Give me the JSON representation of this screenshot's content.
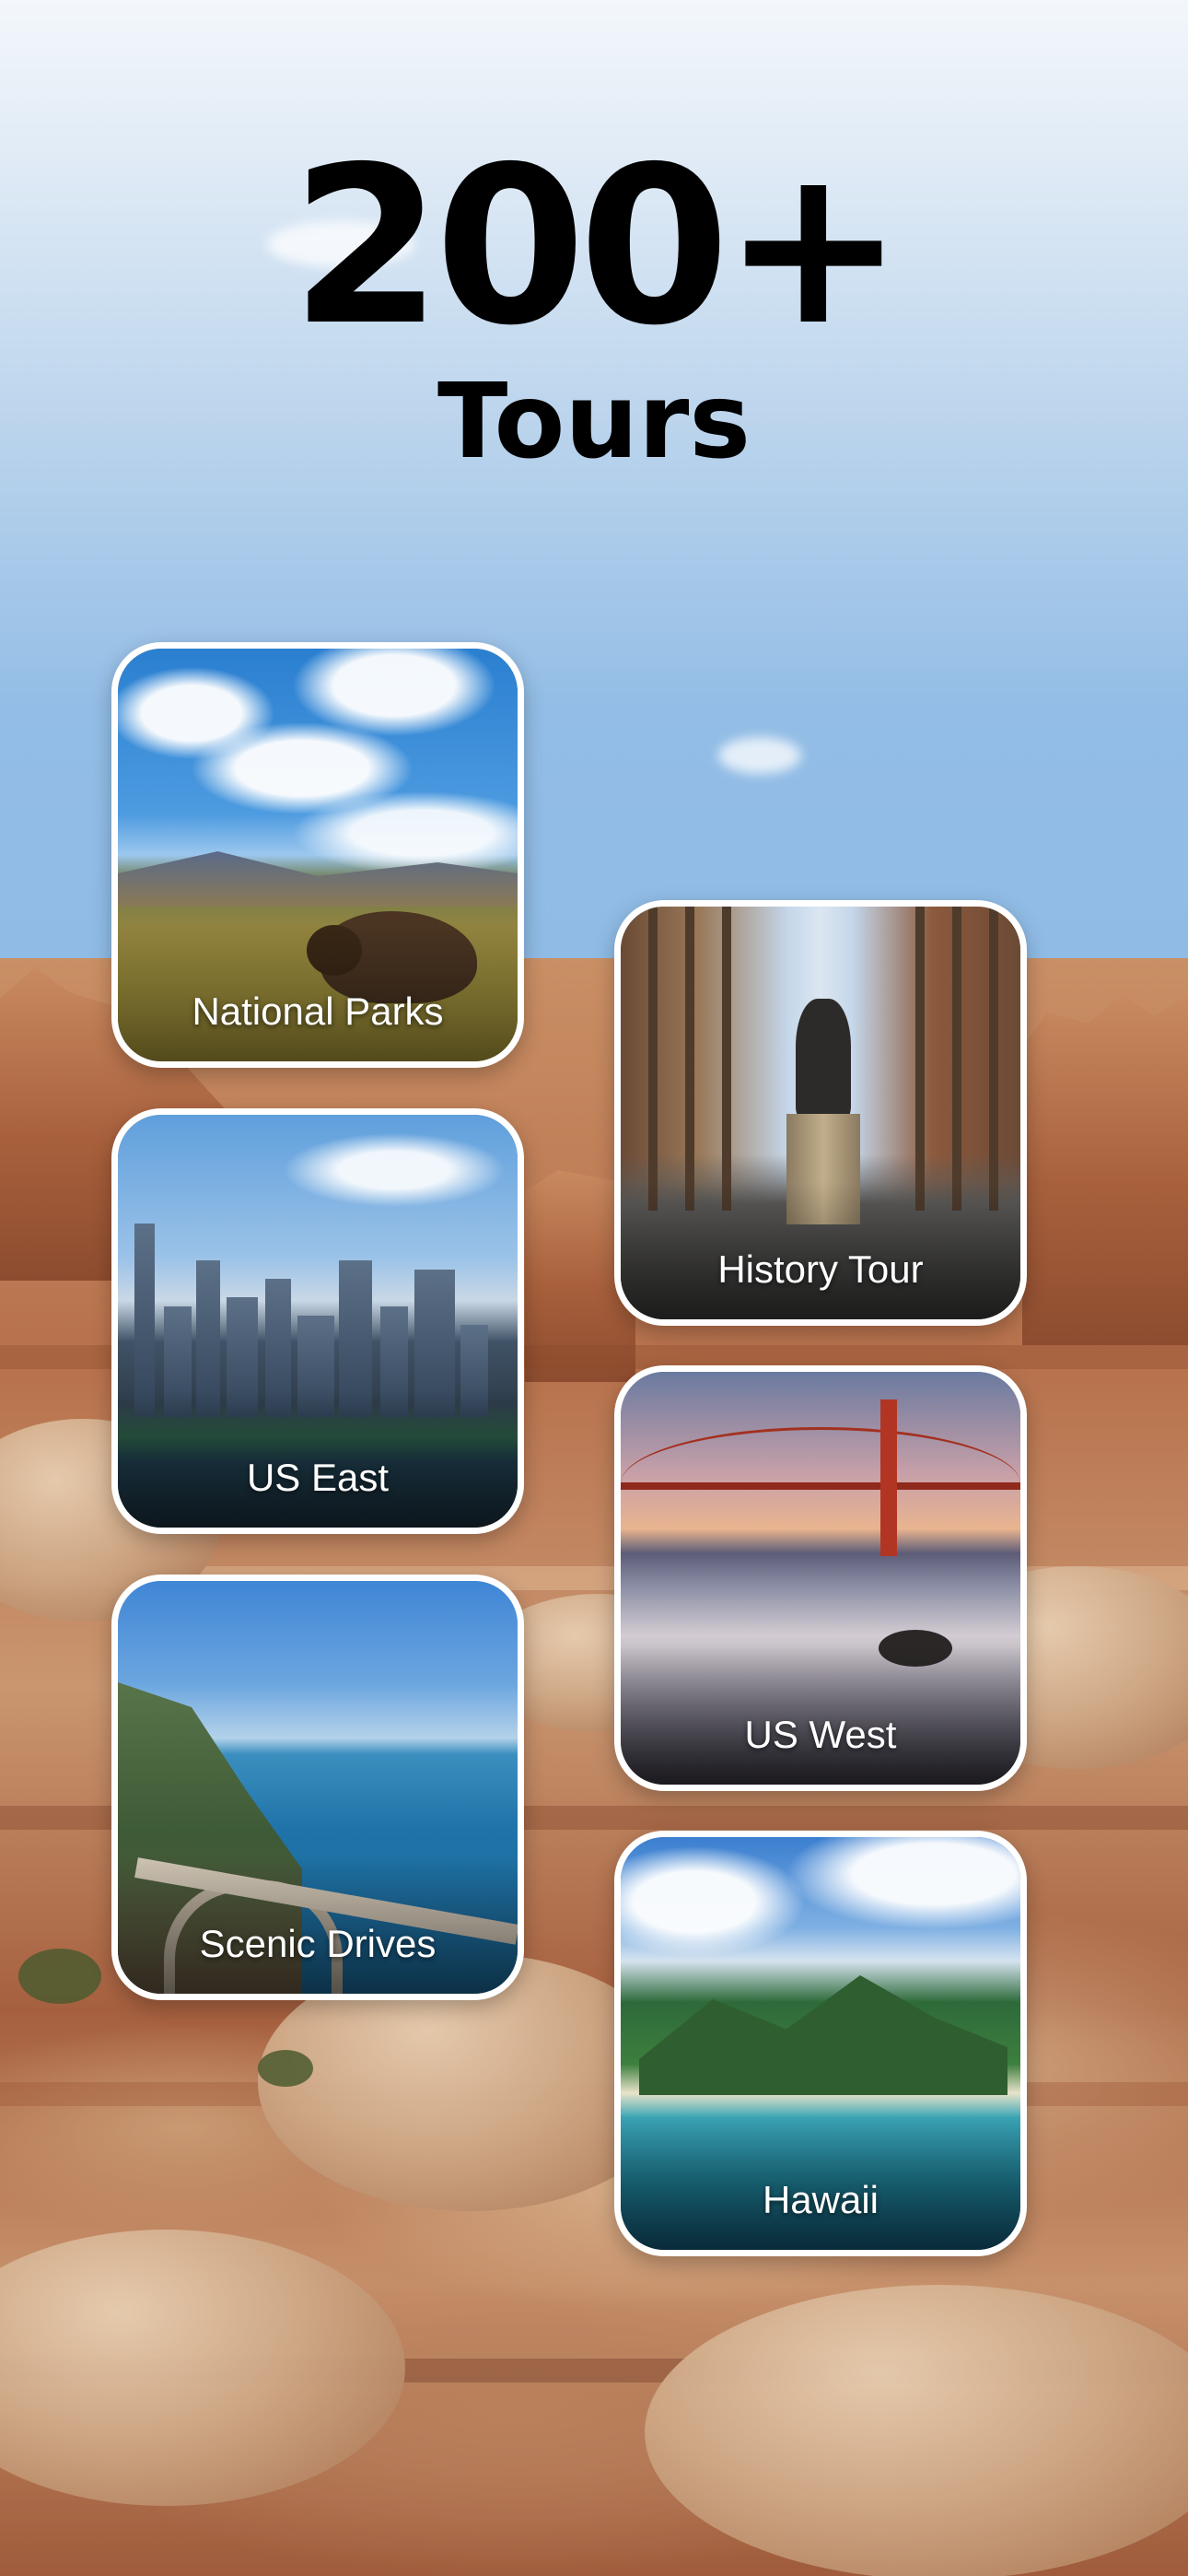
{
  "headline": {
    "number": "200+",
    "subtitle": "Tours"
  },
  "tours": [
    {
      "id": "national-parks",
      "label": "National Parks"
    },
    {
      "id": "history-tour",
      "label": "History Tour"
    },
    {
      "id": "us-east",
      "label": "US East"
    },
    {
      "id": "us-west",
      "label": "US West"
    },
    {
      "id": "scenic-drives",
      "label": "Scenic Drives"
    },
    {
      "id": "hawaii",
      "label": "Hawaii"
    }
  ],
  "colors": {
    "headline": "#000000",
    "card_border": "#ffffff",
    "card_label": "#ffffff"
  }
}
